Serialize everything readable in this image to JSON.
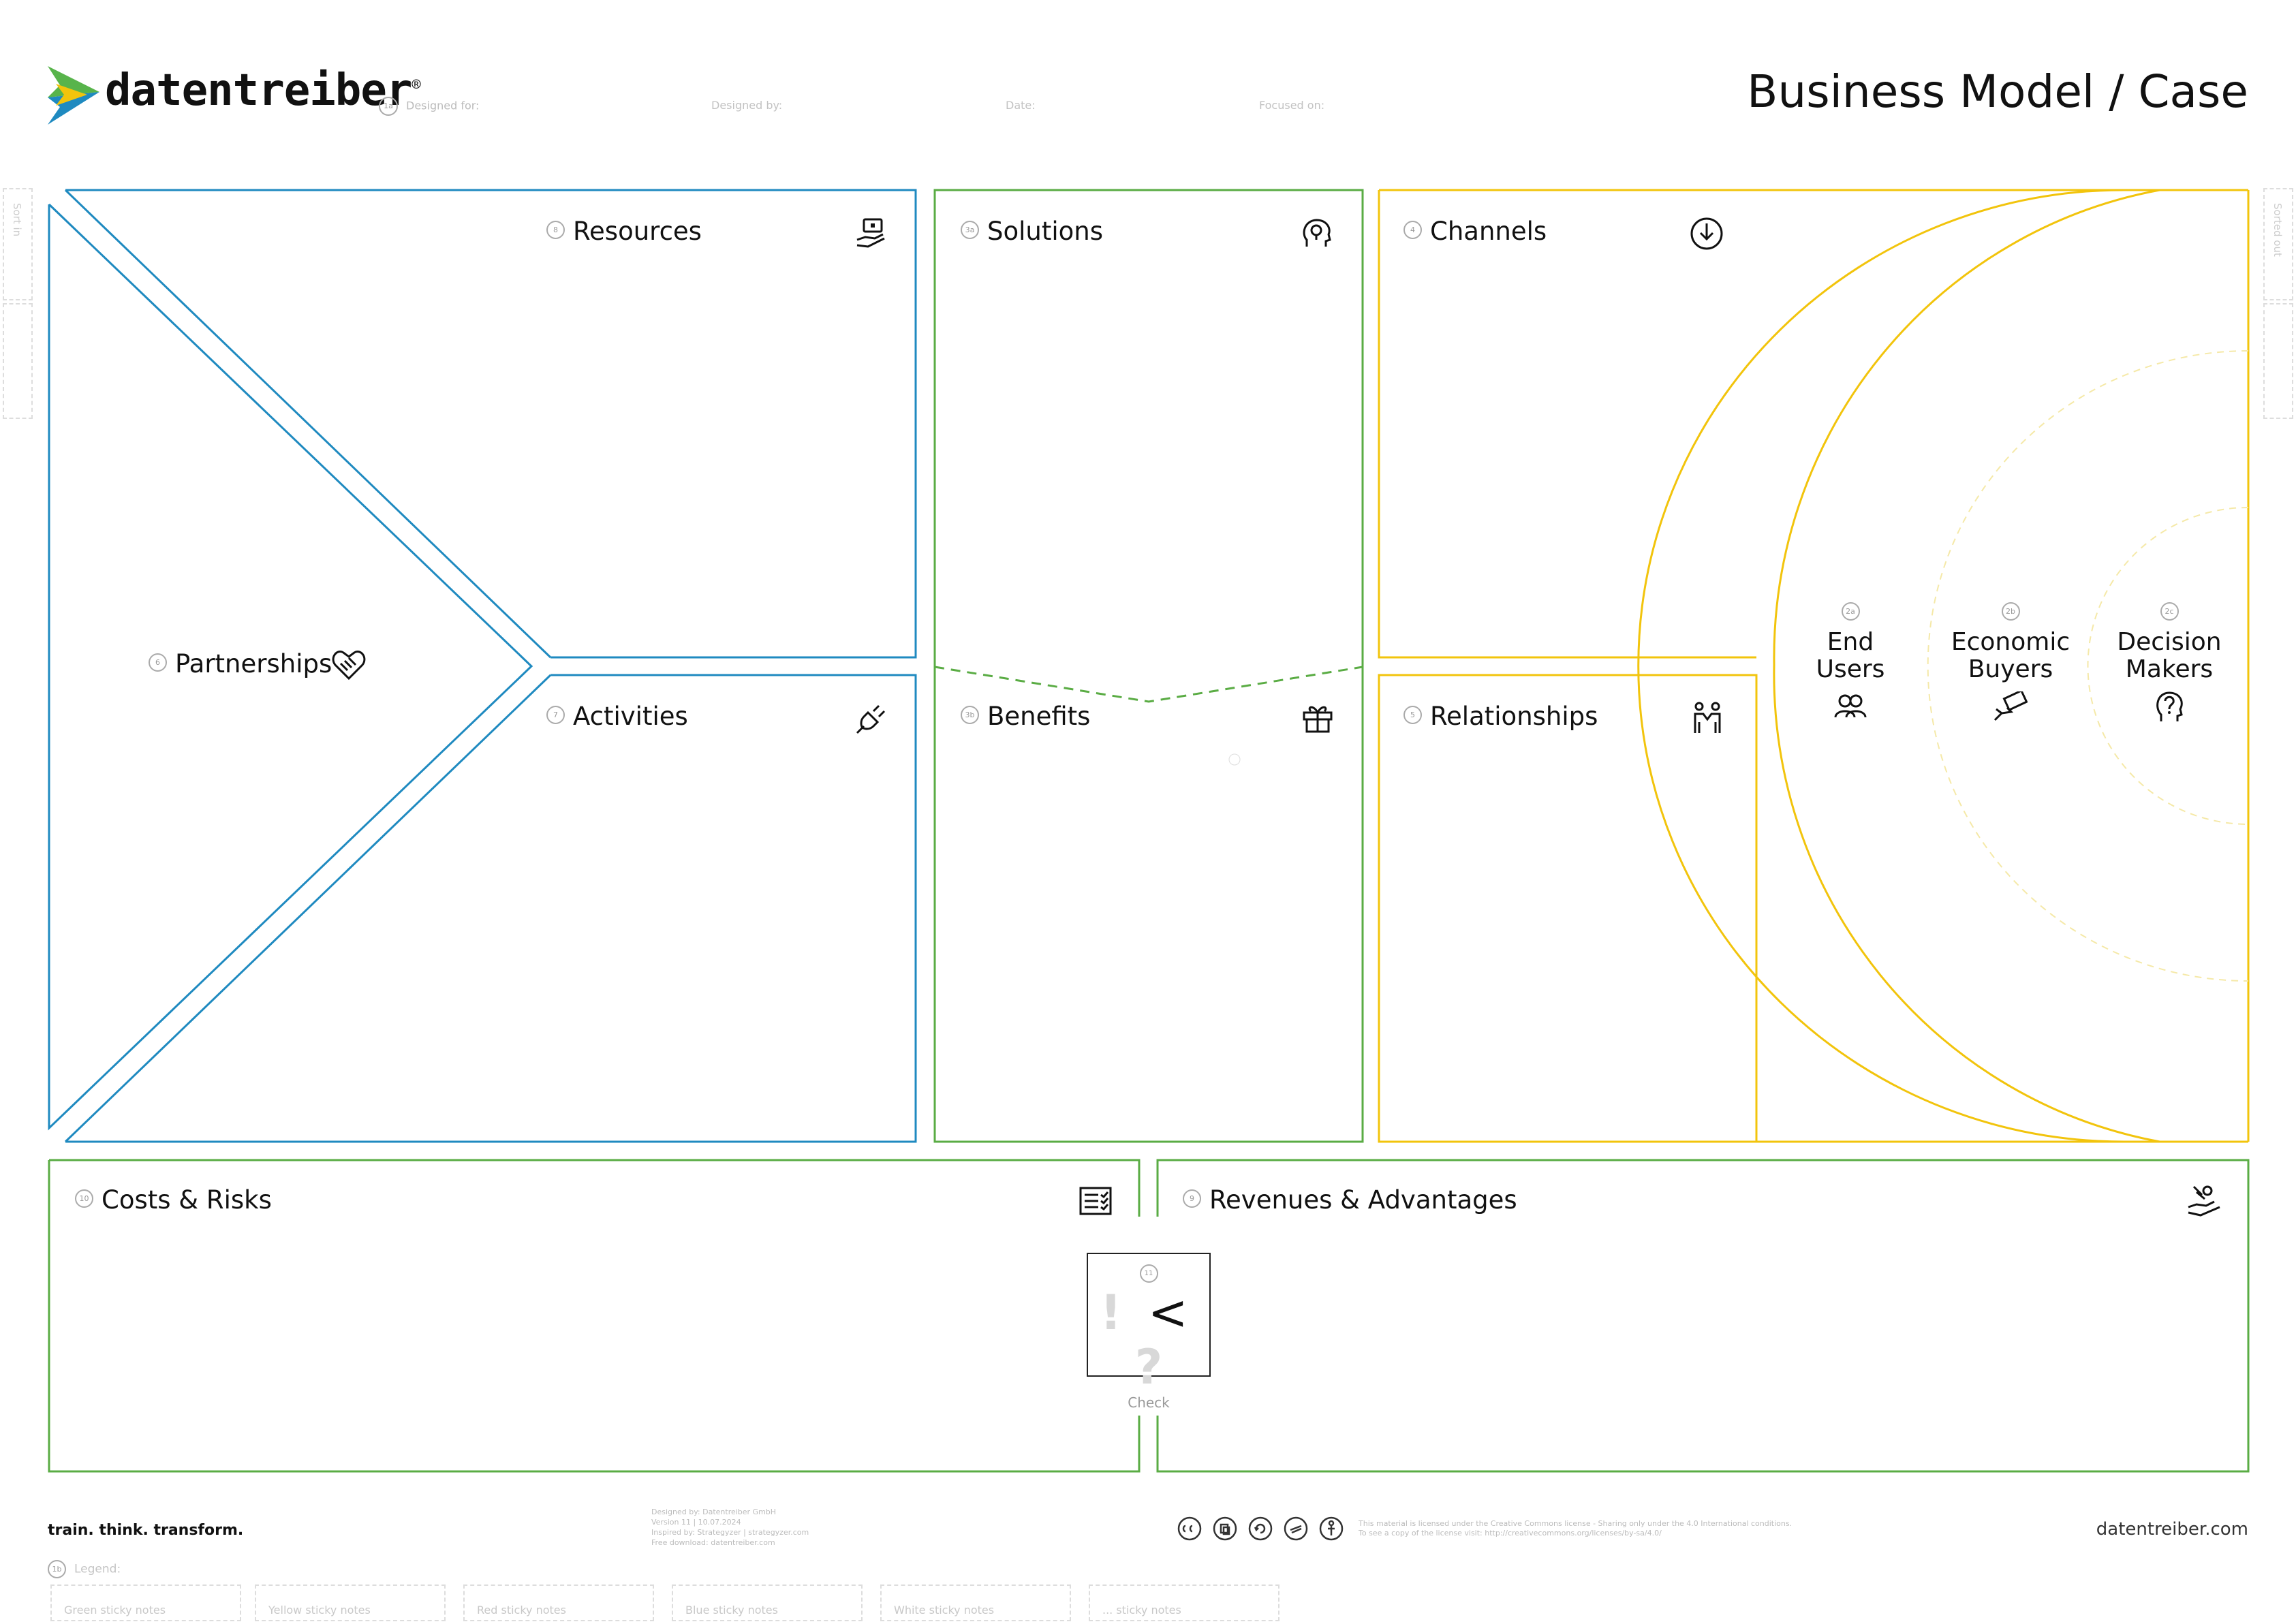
{
  "header": {
    "brand": "datentreiber",
    "registered": "®",
    "title": "Business Model / Case",
    "designed_for_num": "1a",
    "designed_for": "Designed for:",
    "designed_by": "Designed by:",
    "date": "Date:",
    "focused_on": "Focused on:"
  },
  "side": {
    "left": "Sort in",
    "right": "Sorted out"
  },
  "sections": {
    "resources": {
      "num": "8",
      "label": "Resources",
      "icon": "hand-laptop-icon"
    },
    "solutions": {
      "num": "3a",
      "label": "Solutions",
      "icon": "lightbulb-head-icon"
    },
    "channels": {
      "num": "4",
      "label": "Channels",
      "icon": "download-circle-icon"
    },
    "partnerships": {
      "num": "6",
      "label": "Partnerships",
      "icon": "handshake-heart-icon"
    },
    "activities": {
      "num": "7",
      "label": "Activities",
      "icon": "plug-icon"
    },
    "benefits": {
      "num": "3b",
      "label": "Benefits",
      "icon": "gift-icon"
    },
    "relationships": {
      "num": "5",
      "label": "Relationships",
      "icon": "two-people-icon"
    },
    "costs": {
      "num": "10",
      "label": "Costs & Risks",
      "icon": "checklist-icon"
    },
    "revenues": {
      "num": "9",
      "label": "Revenues & Advantages",
      "icon": "hand-coins-icon"
    }
  },
  "segments": [
    {
      "num": "2a",
      "line1": "End",
      "line2": "Users",
      "icon": "users-icon"
    },
    {
      "num": "2b",
      "line1": "Economic",
      "line2": "Buyers",
      "icon": "money-hand-icon"
    },
    {
      "num": "2c",
      "line1": "Decision",
      "line2": "Makers",
      "icon": "question-head-icon"
    }
  ],
  "check": {
    "num": "11",
    "excl": "!",
    "lt": "<",
    "q": "?",
    "label": "Check"
  },
  "footer": {
    "tagline": "train. think. transform.",
    "credit1": "Designed by: Datentreiber GmbH",
    "credit2": "Version 11 | 10.07.2024",
    "credit3": "Inspired by: Strategyzer | strategyzer.com",
    "credit4": "Free download: datentreiber.com",
    "license1": "This material is licensed under the Creative Commons license - Sharing only under the 4.0 International conditions.",
    "license2": "To see a copy of the license visit: http://creativecommons.org/licenses/by-sa/4.0/",
    "site": "datentreiber.com",
    "cc_icons": [
      "cc-icon",
      "copy-icon",
      "share-alike-icon",
      "noncommercial-icon",
      "attribution-icon"
    ]
  },
  "legend": {
    "num": "1b",
    "label": "Legend:",
    "items": [
      "Green sticky notes",
      "Yellow sticky notes",
      "Red sticky notes",
      "Blue sticky notes",
      "White sticky notes",
      "... sticky notes"
    ]
  },
  "colors": {
    "blue": "#1f8ac0",
    "green": "#5aac44",
    "yellow": "#f2c40c",
    "dark": "#111111",
    "logo_green": "#58b44b",
    "logo_yellow": "#f2c40c",
    "logo_blue": "#1f8ac0"
  }
}
